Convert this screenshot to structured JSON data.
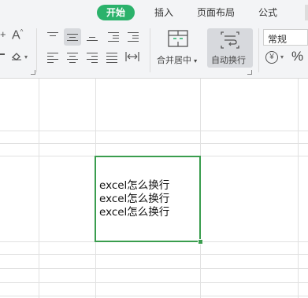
{
  "tabs": [
    {
      "label": "开始",
      "active": true
    },
    {
      "label": "插入",
      "active": false
    },
    {
      "label": "页面布局",
      "active": false
    },
    {
      "label": "公式",
      "active": false
    }
  ],
  "ribbon": {
    "merge_center_label": "合并居中",
    "wrap_text_label": "自动换行",
    "number_format_value": "常规",
    "percent_symbol": "%",
    "currency_symbol": "¥",
    "font_size_glyph": "A"
  },
  "cell": {
    "lines": [
      "excel怎么换行",
      "excel怎么换行",
      "excel怎么换行"
    ]
  },
  "colors": {
    "accent": "#2bb26b",
    "selection_border": "#3a9d4e"
  }
}
